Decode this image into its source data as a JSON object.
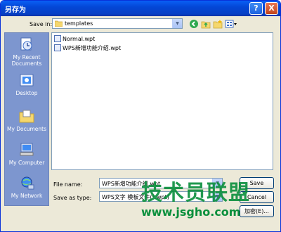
{
  "window": {
    "title": "另存为"
  },
  "titlebar": {
    "help": "?",
    "close": "X"
  },
  "save_in": {
    "label": "Save in:",
    "value": "templates"
  },
  "places": [
    {
      "label": "My Recent\nDocuments",
      "icon": "recent-documents-icon"
    },
    {
      "label": "Desktop",
      "icon": "desktop-icon"
    },
    {
      "label": "My Documents",
      "icon": "my-documents-icon"
    },
    {
      "label": "My Computer",
      "icon": "my-computer-icon"
    },
    {
      "label": "My Network",
      "icon": "my-network-icon"
    }
  ],
  "files": [
    {
      "name": "Normal.wpt"
    },
    {
      "name": "WPS新增功能介绍.wpt"
    }
  ],
  "file_name": {
    "label": "File name:",
    "value": "WPS新增功能介绍.wpt"
  },
  "save_as_type": {
    "label": "Save as type:",
    "value": "WPS文字 模板文件(*.wpt)"
  },
  "buttons": {
    "save": "Save",
    "cancel": "Cancel",
    "encrypt": "加密(E)..."
  },
  "watermark": {
    "text": "技术员联盟",
    "url": "www.jsgho.com"
  }
}
